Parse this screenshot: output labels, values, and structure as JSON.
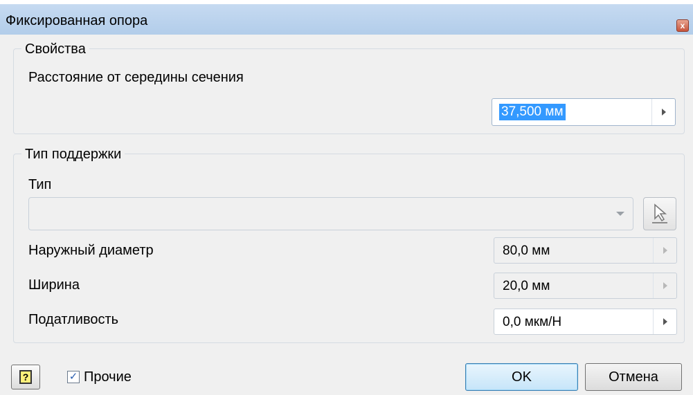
{
  "window": {
    "title": "Фиксированная опора",
    "close_glyph": "x"
  },
  "properties_group": {
    "legend": "Свойства",
    "distance_label": "Расстояние от середины сечения",
    "distance_value": "37,500 мм"
  },
  "support_group": {
    "legend": "Тип поддержки",
    "type_label": "Тип",
    "type_value": "",
    "outer_diameter_label": "Наружный диаметр",
    "outer_diameter_value": "80,0 мм",
    "width_label": "Ширина",
    "width_value": "20,0 мм",
    "compliance_label": "Податливость",
    "compliance_value": "0,0 мкм/Н"
  },
  "footer": {
    "help_glyph": "?",
    "other_checkbox_label": "Прочие",
    "other_checked": true,
    "ok_label": "OK",
    "cancel_label": "Отмена"
  }
}
